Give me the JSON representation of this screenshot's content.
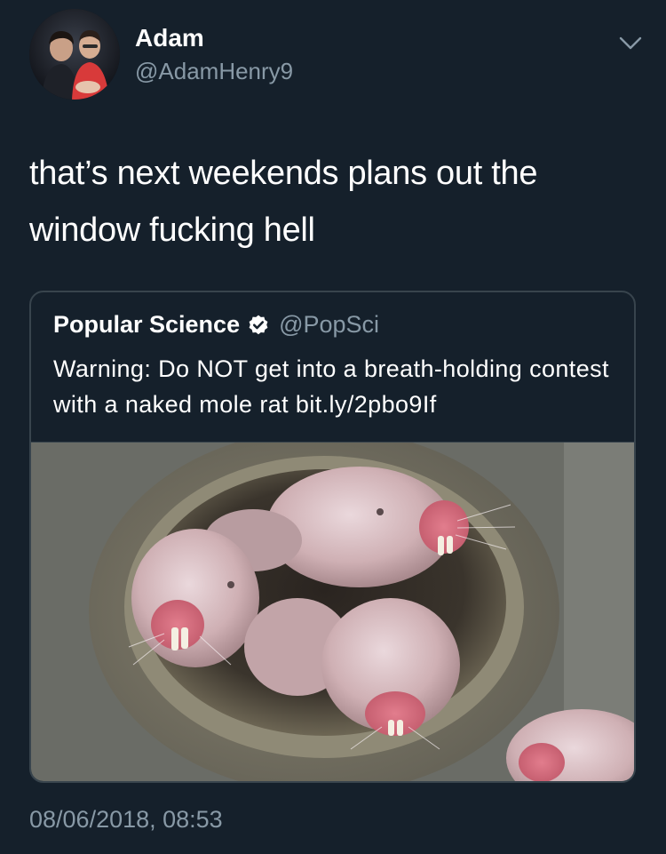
{
  "author": {
    "display_name": "Adam",
    "handle": "@AdamHenry9",
    "avatar": "profile-photo-avatar"
  },
  "tweet": {
    "text": "that’s next weekends plans out the window fucking hell",
    "timestamp": "08/06/2018, 08:53",
    "menu_icon": "chevron-down-icon"
  },
  "quoted_tweet": {
    "display_name": "Popular Science",
    "verified_icon": "verified-badge-icon",
    "handle": "@PopSci",
    "text": "Warning: Do NOT get into a breath-holding contest with a naked mole rat bit.ly/2pbo9If",
    "image": "naked-mole-rats-in-pipe-photo"
  },
  "colors": {
    "background": "#15202b",
    "primary_text": "#ffffff",
    "secondary_text": "#8899a6",
    "border": "#38444d"
  }
}
